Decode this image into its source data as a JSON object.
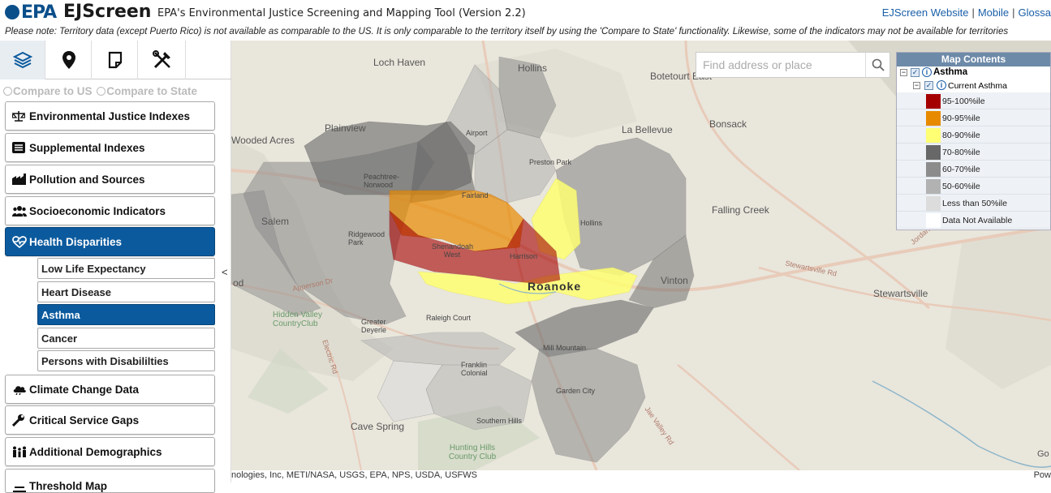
{
  "header": {
    "logo_text": "EPA",
    "app_name": "EJScreen",
    "subtitle": "EPA's Environmental Justice Screening and Mapping Tool (Version 2.2)",
    "links": [
      "EJScreen Website",
      "Mobile",
      "Glossa"
    ]
  },
  "notice": "Please note: Territory data (except Puerto Rico) is not available as comparable to the US. It is only comparable to the territory itself by using the 'Compare to State' functionality. Likewise, some of the indicators may not be available for territories",
  "sidebar": {
    "tabs": [
      "layers-icon",
      "location-pin-icon",
      "notes-icon",
      "tools-icon"
    ],
    "compare_us": "Compare to US",
    "compare_state": "Compare to State",
    "menu": [
      {
        "label": "Environmental Justice Indexes",
        "icon": "scales-icon"
      },
      {
        "label": "Supplemental Indexes",
        "icon": "list-icon"
      },
      {
        "label": "Pollution and Sources",
        "icon": "factory-icon"
      },
      {
        "label": "Socioeconomic Indicators",
        "icon": "people-icon"
      },
      {
        "label": "Health Disparities",
        "icon": "heartbeat-icon",
        "active": true
      }
    ],
    "submenu": [
      {
        "label": "Low Life Expectancy"
      },
      {
        "label": "Heart Disease"
      },
      {
        "label": "Asthma",
        "active": true
      },
      {
        "label": "Cancer"
      },
      {
        "label": "Persons with Disabililties"
      }
    ],
    "menu2": [
      {
        "label": "Climate Change Data",
        "icon": "cloud-icon"
      },
      {
        "label": "Critical Service Gaps",
        "icon": "wrench-icon"
      },
      {
        "label": "Additional Demographics",
        "icon": "family-icon"
      },
      {
        "label": "Threshold Map",
        "icon": "threshold-icon"
      }
    ],
    "collapse_label": "<"
  },
  "map": {
    "search_placeholder": "Find address or place",
    "labels": [
      {
        "text": "Loch Haven"
      },
      {
        "text": "Hollins"
      },
      {
        "text": "Botetourt East"
      },
      {
        "text": "Plainview"
      },
      {
        "text": "La Bellevue"
      },
      {
        "text": "Bonsack"
      },
      {
        "text": "Wooded Acres"
      },
      {
        "text": "Airport"
      },
      {
        "text": "Preston Park"
      },
      {
        "text": "Peachtree-Norwood"
      },
      {
        "text": "Fairland"
      },
      {
        "text": "Salem"
      },
      {
        "text": "Hollins"
      },
      {
        "text": "Falling Creek"
      },
      {
        "text": "Ridgewood Park"
      },
      {
        "text": "Shenandoah West"
      },
      {
        "text": "Harrison"
      },
      {
        "text": "Roanoke"
      },
      {
        "text": "Vinton"
      },
      {
        "text": "Stewartsville"
      },
      {
        "text": "Hidden Valley CountryClub"
      },
      {
        "text": "Greater Deyerle"
      },
      {
        "text": "Raleigh Court"
      },
      {
        "text": "Mill Mountain"
      },
      {
        "text": "Franklin Colonial"
      },
      {
        "text": "Garden City"
      },
      {
        "text": "Cave Spring"
      },
      {
        "text": "Southern Hills"
      },
      {
        "text": "Hunting Hills Country Club"
      },
      {
        "text": "Apperson Dr"
      },
      {
        "text": "Electric Rd"
      },
      {
        "text": "Stewartsville Rd"
      },
      {
        "text": "Jae Valley Rd"
      },
      {
        "text": "Jordan"
      },
      {
        "text": "od"
      }
    ],
    "attribution": "nologies, Inc, METI/NASA, USGS, EPA, NPS, USDA, USFWS",
    "powered": "Pow",
    "google": "Go"
  },
  "legend": {
    "title": "Map Contents",
    "layer": "Asthma",
    "sublayer": "Current Asthma",
    "items": [
      {
        "label": "95-100%ile",
        "color": "#a50000"
      },
      {
        "label": "90-95%ile",
        "color": "#e88a00"
      },
      {
        "label": "80-90%ile",
        "color": "#ffff73"
      },
      {
        "label": "70-80%ile",
        "color": "#686868"
      },
      {
        "label": "60-70%ile",
        "color": "#8c8c8c"
      },
      {
        "label": "50-60%ile",
        "color": "#b2b2b2"
      },
      {
        "label": "Less than 50%ile",
        "color": "#dcdcdc"
      },
      {
        "label": "Data Not Available",
        "color": "#ffffff"
      }
    ]
  }
}
